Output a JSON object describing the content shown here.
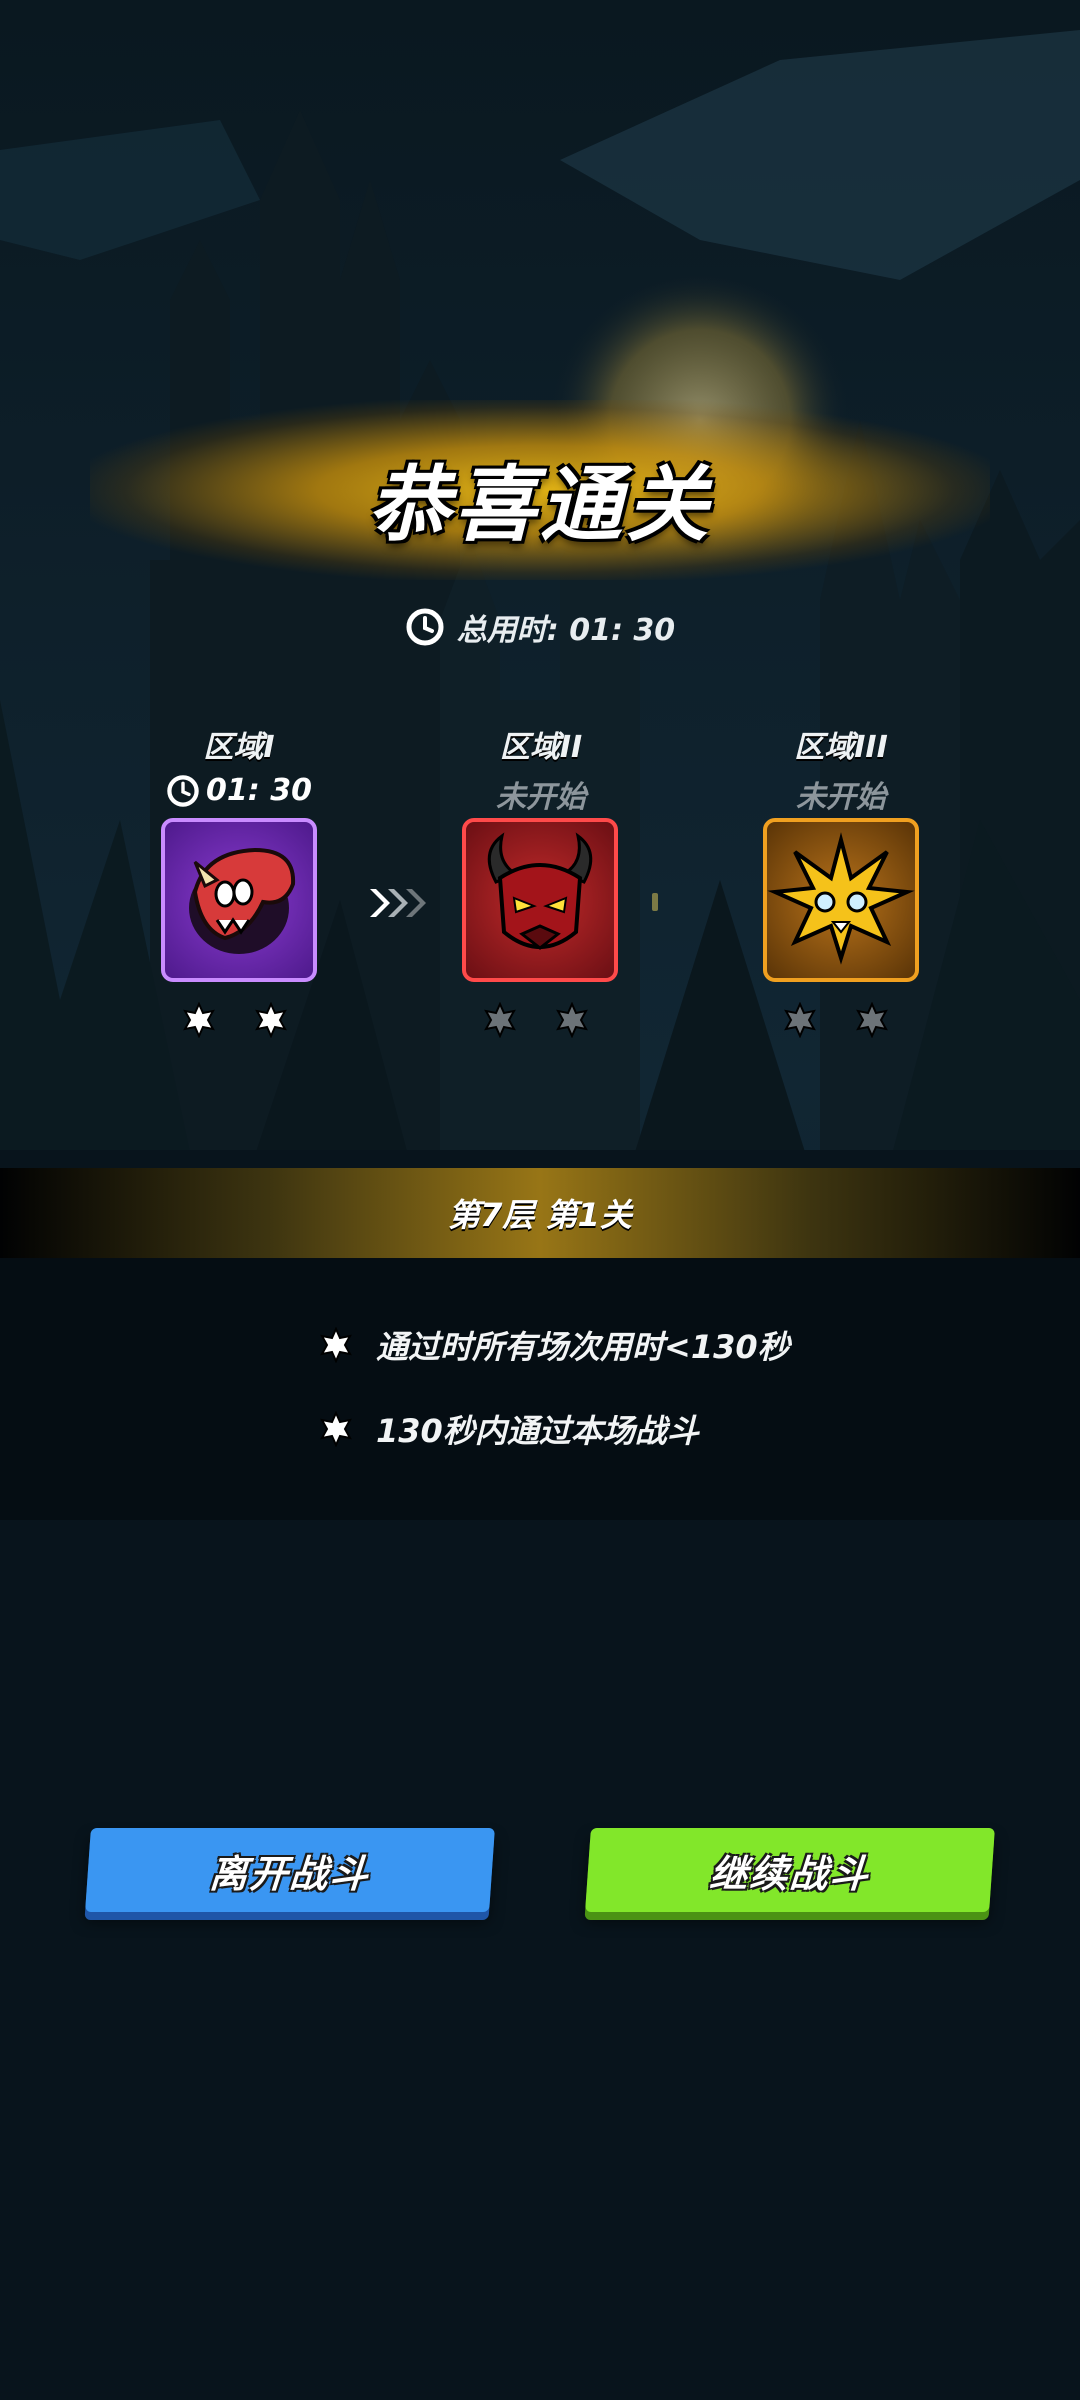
{
  "header": {
    "title": "恭喜通关",
    "total_time_label": "总用时: 01: 30"
  },
  "zones": [
    {
      "name": "区域I",
      "status": "01: 30",
      "state": "cleared",
      "stars_earned": 2,
      "stars_total": 2,
      "portrait_icon": "horned-beast-icon"
    },
    {
      "name": "区域II",
      "status": "未开始",
      "state": "not-started",
      "stars_earned": 0,
      "stars_total": 2,
      "portrait_icon": "demon-mask-icon"
    },
    {
      "name": "区域III",
      "status": "未开始",
      "state": "not-started",
      "stars_earned": 0,
      "stars_total": 2,
      "portrait_icon": "spiky-creature-icon"
    }
  ],
  "floor": {
    "label": "第7层 第1关"
  },
  "conditions": [
    {
      "text": "通过时所有场次用时<130秒"
    },
    {
      "text": "130秒内通过本场战斗"
    }
  ],
  "buttons": {
    "leave": "离开战斗",
    "continue": "继续战斗"
  },
  "colors": {
    "background": "#08141c",
    "title_glow": "#e6b414",
    "leave_button": "#3a96f2",
    "continue_button": "#82e72a",
    "zone1_border": "#c98cff",
    "zone2_border": "#ff4a4a",
    "zone3_border": "#f0a020",
    "star_earned": "#ffffff",
    "star_unearned": "#6c7378"
  }
}
